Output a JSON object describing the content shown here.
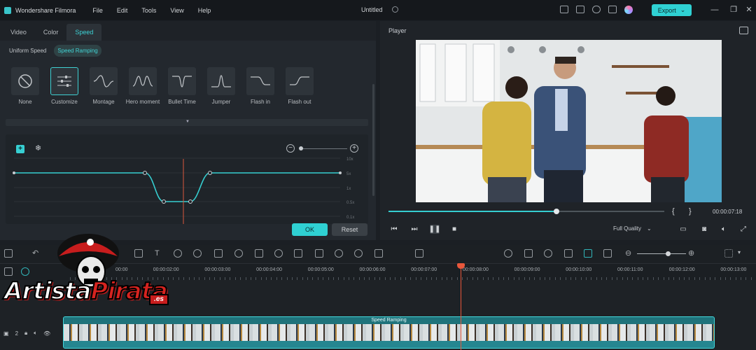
{
  "app": {
    "name": "Wondershare Filmora",
    "menu": [
      "File",
      "Edit",
      "Tools",
      "View",
      "Help"
    ],
    "document_title": "Untitled",
    "export_label": "Export"
  },
  "left_panel": {
    "tabs": [
      "Video",
      "Color",
      "Speed"
    ],
    "active_tab": "Speed",
    "subtabs": [
      "Uniform Speed",
      "Speed Ramping"
    ],
    "active_subtab": "Speed Ramping",
    "presets": [
      {
        "label": "None",
        "icon": "no-sign-icon"
      },
      {
        "label": "Customize",
        "icon": "sliders-icon"
      },
      {
        "label": "Montage",
        "icon": "montage-curve-icon"
      },
      {
        "label": "Hero moment",
        "icon": "hero-curve-icon"
      },
      {
        "label": "Bullet Time",
        "icon": "bullet-curve-icon"
      },
      {
        "label": "Jumper",
        "icon": "jumper-curve-icon"
      },
      {
        "label": "Flash in",
        "icon": "flash-in-curve-icon"
      },
      {
        "label": "Flash out",
        "icon": "flash-out-curve-icon"
      }
    ],
    "selected_preset": "Customize",
    "curve_axis_labels": [
      "10x",
      "5x",
      "1x",
      "0.5x",
      "0.1x"
    ],
    "ok_label": "OK",
    "reset_label": "Reset",
    "accent_color": "#2fd1d3"
  },
  "player": {
    "title": "Player",
    "timecode": "00:00:07:18",
    "progress": 0.61,
    "quality_label": "Full Quality",
    "brace_open": "{",
    "brace_close": "}"
  },
  "timeline": {
    "ruler_labels": [
      "00:00",
      "00:00:02:00",
      "00:00:03:00",
      "00:00:04:00",
      "00:00:05:00",
      "00:00:06:00",
      "00:00:07:00",
      "00:00:08:00",
      "00:00:09:00",
      "00:00:10:00",
      "00:00:11:00",
      "00:00:12:00",
      "00:00:13:00"
    ],
    "clip_label": "Speed Ramping",
    "track_number": "2",
    "playhead_color": "#e8573b"
  },
  "watermark": {
    "text_a": "Artista",
    "text_b": "Pirata",
    "badge": ".es"
  }
}
